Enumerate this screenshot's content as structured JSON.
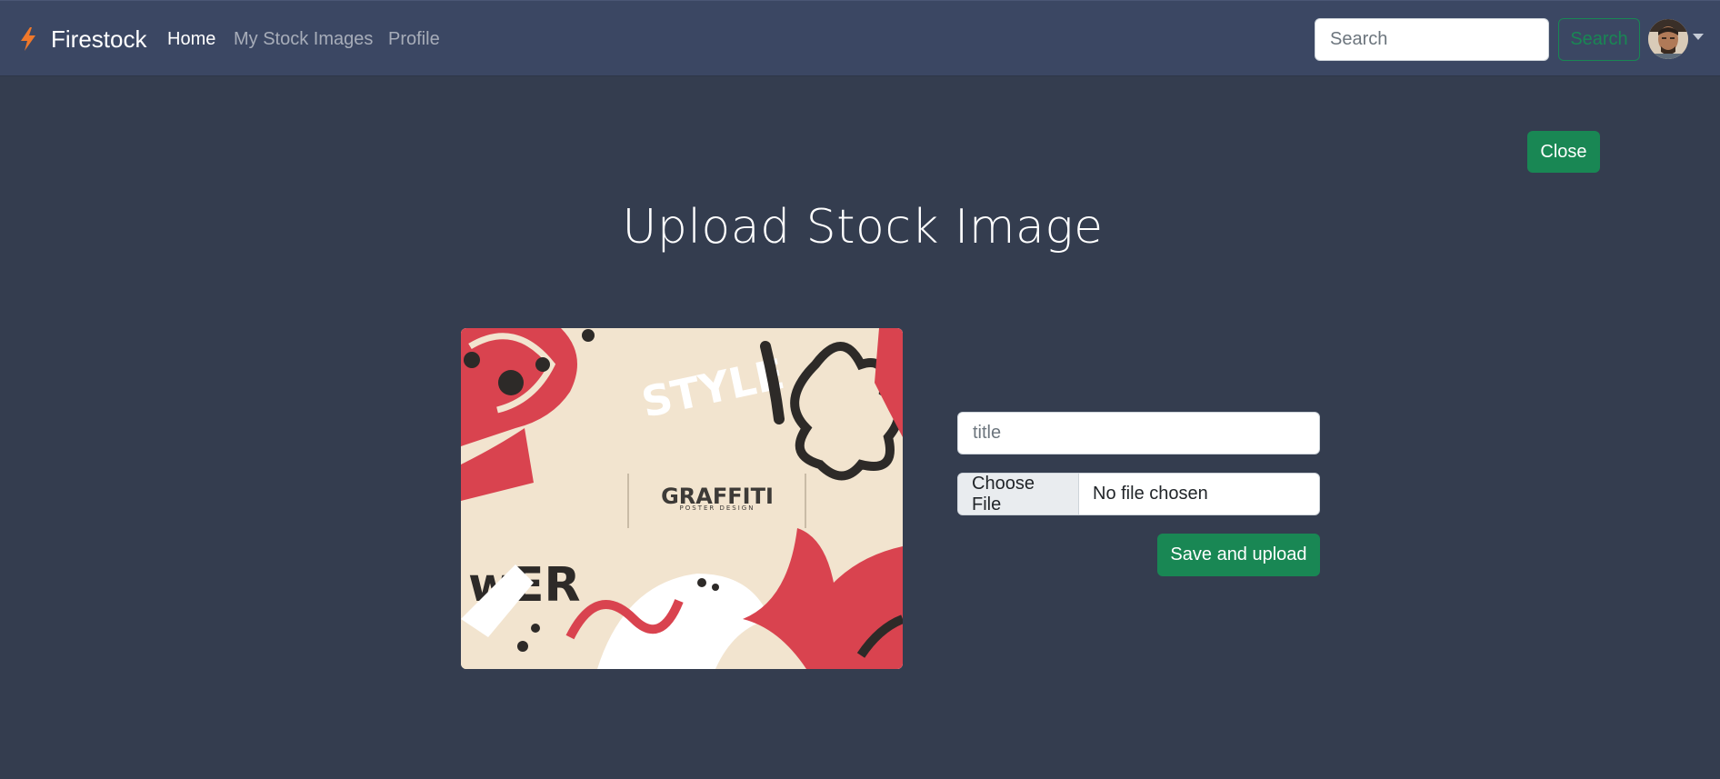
{
  "navbar": {
    "brand": "Firestock",
    "links": [
      "Home",
      "My Stock Images",
      "Profile"
    ],
    "search_placeholder": "Search",
    "search_button": "Search"
  },
  "main": {
    "close_button": "Close",
    "title": "Upload Stock Image",
    "preview_image": {
      "headline": "GRAFFITI",
      "subline": "POSTER DESIGN",
      "words": [
        "STYLE",
        "wER"
      ]
    },
    "form": {
      "title_placeholder": "title",
      "file_button": "Choose File",
      "file_status": "No file chosen",
      "submit_button": "Save and upload"
    }
  },
  "colors": {
    "page_bg": "#343d4f",
    "navbar_bg": "#3b4763",
    "accent_green": "#198754",
    "brand_icon": "#f0782a"
  }
}
